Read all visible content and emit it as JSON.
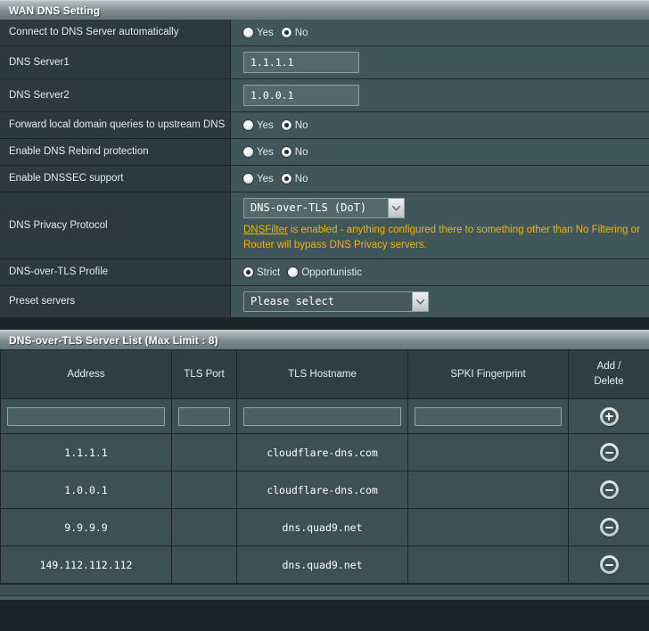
{
  "wan_panel": {
    "title": "WAN DNS Setting",
    "rows": [
      {
        "label": "Connect to DNS Server automatically",
        "type": "radio",
        "options": [
          {
            "label": "Yes",
            "selected": false
          },
          {
            "label": "No",
            "selected": true
          }
        ]
      },
      {
        "label": "DNS Server1",
        "type": "text",
        "value": "1.1.1.1"
      },
      {
        "label": "DNS Server2",
        "type": "text",
        "value": "1.0.0.1"
      },
      {
        "label": "Forward local domain queries to upstream DNS",
        "type": "radio",
        "options": [
          {
            "label": "Yes",
            "selected": false
          },
          {
            "label": "No",
            "selected": true
          }
        ]
      },
      {
        "label": "Enable DNS Rebind protection",
        "type": "radio",
        "options": [
          {
            "label": "Yes",
            "selected": false
          },
          {
            "label": "No",
            "selected": true
          }
        ]
      },
      {
        "label": "Enable DNSSEC support",
        "type": "radio",
        "options": [
          {
            "label": "Yes",
            "selected": false
          },
          {
            "label": "No",
            "selected": true
          }
        ]
      }
    ],
    "privacy_protocol": {
      "label": "DNS Privacy Protocol",
      "selected": "DNS-over-TLS (DoT)",
      "note_link": "DNSFilter",
      "note_text": " is enabled - anything configured there to something other than No Filtering or Router will bypass DNS Privacy servers."
    },
    "dot_profile": {
      "label": "DNS-over-TLS Profile",
      "options": [
        {
          "label": "Strict",
          "selected": true
        },
        {
          "label": "Opportunistic",
          "selected": false
        }
      ]
    },
    "preset_servers": {
      "label": "Preset servers",
      "selected": "Please select"
    }
  },
  "server_panel": {
    "title": "DNS-over-TLS Server List (Max Limit : 8)",
    "columns": [
      "Address",
      "TLS Port",
      "TLS Hostname",
      "SPKI Fingerprint",
      "Add / Delete"
    ],
    "action_header_line1": "Add /",
    "action_header_line2": "Delete",
    "new_row": {
      "address": "",
      "tls_port": "",
      "tls_hostname": "",
      "spki_fingerprint": "",
      "action_icon": "plus-circle-icon"
    },
    "rows": [
      {
        "address": "1.1.1.1",
        "tls_port": "",
        "tls_hostname": "cloudflare-dns.com",
        "spki_fingerprint": "",
        "action_icon": "minus-circle-icon"
      },
      {
        "address": "1.0.0.1",
        "tls_port": "",
        "tls_hostname": "cloudflare-dns.com",
        "spki_fingerprint": "",
        "action_icon": "minus-circle-icon"
      },
      {
        "address": "9.9.9.9",
        "tls_port": "",
        "tls_hostname": "dns.quad9.net",
        "spki_fingerprint": "",
        "action_icon": "minus-circle-icon"
      },
      {
        "address": "149.112.112.112",
        "tls_port": "",
        "tls_hostname": "dns.quad9.net",
        "spki_fingerprint": "",
        "action_icon": "minus-circle-icon"
      }
    ]
  },
  "colors": {
    "note": "#f0b400",
    "panel_bg": "#2f3e42",
    "value_bg": "#41565a",
    "row_bg": "#3d5155"
  }
}
